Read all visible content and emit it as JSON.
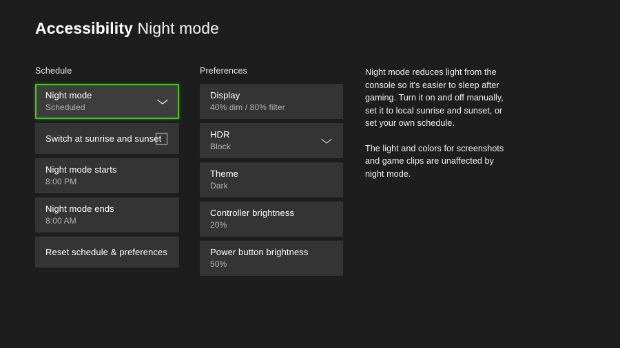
{
  "header": {
    "app_section": "Accessibility",
    "page_title": "Night mode"
  },
  "schedule": {
    "heading": "Schedule",
    "items": [
      {
        "title": "Night mode",
        "value": "Scheduled",
        "icon": "chevron-down-icon",
        "focused": true
      },
      {
        "title": "Switch at sunrise and sunset",
        "value": "",
        "icon": "checkbox-unchecked",
        "focused": false
      },
      {
        "title": "Night mode starts",
        "value": "8:00 PM",
        "icon": "",
        "focused": false
      },
      {
        "title": "Night mode ends",
        "value": "8:00 AM",
        "icon": "",
        "focused": false
      },
      {
        "title": "Reset schedule & preferences",
        "value": "",
        "icon": "",
        "focused": false
      }
    ]
  },
  "preferences": {
    "heading": "Preferences",
    "items": [
      {
        "title": "Display",
        "value": "40% dim / 80% filter",
        "icon": "",
        "focused": false
      },
      {
        "title": "HDR",
        "value": "Block",
        "icon": "chevron-down-icon",
        "focused": false
      },
      {
        "title": "Theme",
        "value": "Dark",
        "icon": "",
        "focused": false
      },
      {
        "title": "Controller brightness",
        "value": "20%",
        "icon": "",
        "focused": false
      },
      {
        "title": "Power button brightness",
        "value": "50%",
        "icon": "",
        "focused": false
      }
    ]
  },
  "info": {
    "paragraphs": [
      "Night mode reduces light from the console so it's easier to sleep after gaming. Turn it on and off manually, set it to local sunrise and sunset, or set your own schedule.",
      "The light and colors for screenshots and game clips are unaffected by night mode."
    ]
  },
  "colors": {
    "background": "#1d1d1d",
    "tile": "#343434",
    "tile_focused": "#3d3d3d",
    "focus_accent": "#4ec422",
    "primary_text": "#ffffff",
    "secondary_text": "#b4b4b4"
  }
}
